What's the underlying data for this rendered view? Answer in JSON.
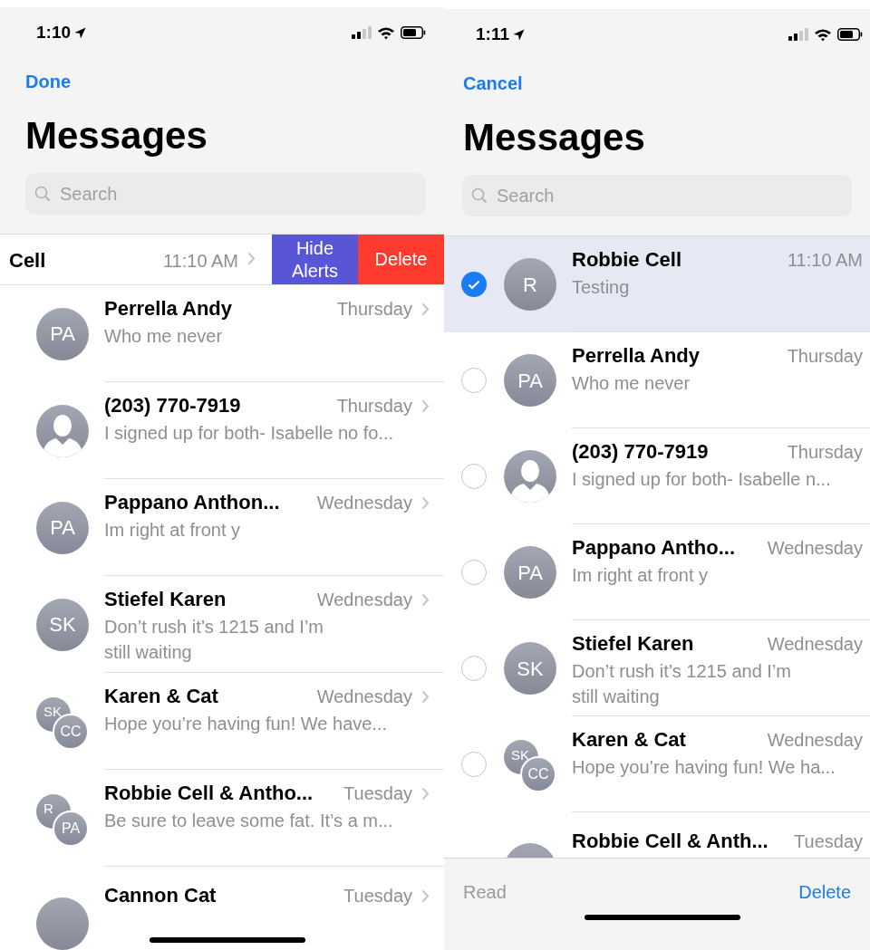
{
  "screens": [
    {
      "chevrons": true,
      "status_time": "1:10",
      "nav_button": "Done",
      "title": "Messages",
      "search": {
        "placeholder": "Search"
      },
      "conversations": [
        {
          "kind": "swiped",
          "name": "Cell",
          "time": "11:10 AM",
          "actions": [
            {
              "label": "Hide\nAlerts",
              "kind": "mute"
            },
            {
              "label": "Delete",
              "kind": "delete"
            }
          ]
        },
        {
          "kind": "normal",
          "name": "Perrella Andy",
          "time": "Thursday",
          "preview": "Who me never",
          "avatar": {
            "kind": "initials",
            "initials": [
              "PA"
            ]
          }
        },
        {
          "kind": "normal",
          "name": "(203) 770-7919",
          "time": "Thursday",
          "preview": "I signed up for both- Isabelle no fo...",
          "avatar": {
            "kind": "contact"
          }
        },
        {
          "kind": "normal",
          "name": "Pappano Anthon...",
          "time": "Wednesday",
          "preview": "Im right at front y",
          "avatar": {
            "kind": "initials",
            "initials": [
              "PA"
            ]
          }
        },
        {
          "kind": "normal",
          "name": "Stiefel Karen",
          "time": "Wednesday",
          "preview": "Don’t rush it’s 1215 and I’m\nstill waiting",
          "avatar": {
            "kind": "initials",
            "initials": [
              "SK"
            ]
          }
        },
        {
          "kind": "normal",
          "name": "Karen & Cat",
          "time": "Wednesday",
          "preview": "Hope you’re having fun! We have...",
          "avatar": {
            "kind": "group",
            "initials": [
              "SK",
              "CC"
            ]
          }
        },
        {
          "kind": "normal",
          "name": "Robbie Cell & Antho...",
          "time": "Tuesday",
          "preview": "Be sure to leave some fat. It’s a m...",
          "avatar": {
            "kind": "group",
            "initials": [
              "R",
              "PA"
            ]
          }
        },
        {
          "kind": "partial",
          "name": "Cannon Cat",
          "time": "Tuesday",
          "avatar": {
            "kind": "blank"
          }
        }
      ]
    },
    {
      "chevrons": false,
      "status_time": "1:11",
      "nav_button": "Cancel",
      "title": "Messages",
      "search": {
        "placeholder": "Search"
      },
      "conversations": [
        {
          "kind": "normal",
          "selected": true,
          "name": "Robbie Cell",
          "time": "11:10 AM",
          "preview": "Testing",
          "avatar": {
            "kind": "initials",
            "initials": [
              "R"
            ]
          }
        },
        {
          "kind": "normal",
          "selected": false,
          "name": "Perrella Andy",
          "time": "Thursday",
          "preview": "Who me never",
          "avatar": {
            "kind": "initials",
            "initials": [
              "PA"
            ]
          }
        },
        {
          "kind": "normal",
          "selected": false,
          "name": "(203) 770-7919",
          "time": "Thursday",
          "preview": "I signed up for both- Isabelle n...",
          "avatar": {
            "kind": "contact"
          }
        },
        {
          "kind": "normal",
          "selected": false,
          "name": "Pappano Antho...",
          "time": "Wednesday",
          "preview": "Im right at front y",
          "avatar": {
            "kind": "initials",
            "initials": [
              "PA"
            ]
          }
        },
        {
          "kind": "normal",
          "selected": false,
          "name": "Stiefel Karen",
          "time": "Wednesday",
          "preview": "Don’t rush it’s 1215 and I’m\nstill waiting",
          "avatar": {
            "kind": "initials",
            "initials": [
              "SK"
            ]
          }
        },
        {
          "kind": "normal",
          "selected": false,
          "name": "Karen & Cat",
          "time": "Wednesday",
          "preview": "Hope you’re having fun! We ha...",
          "avatar": {
            "kind": "group",
            "initials": [
              "SK",
              "CC"
            ]
          }
        },
        {
          "kind": "partial",
          "name": "Robbie Cell & Anth...",
          "time": "Tuesday",
          "avatar": {
            "kind": "blank"
          }
        }
      ],
      "toolbar": [
        {
          "label": "Read",
          "disabled": true
        },
        {
          "label": "Delete",
          "disabled": false
        }
      ]
    }
  ]
}
